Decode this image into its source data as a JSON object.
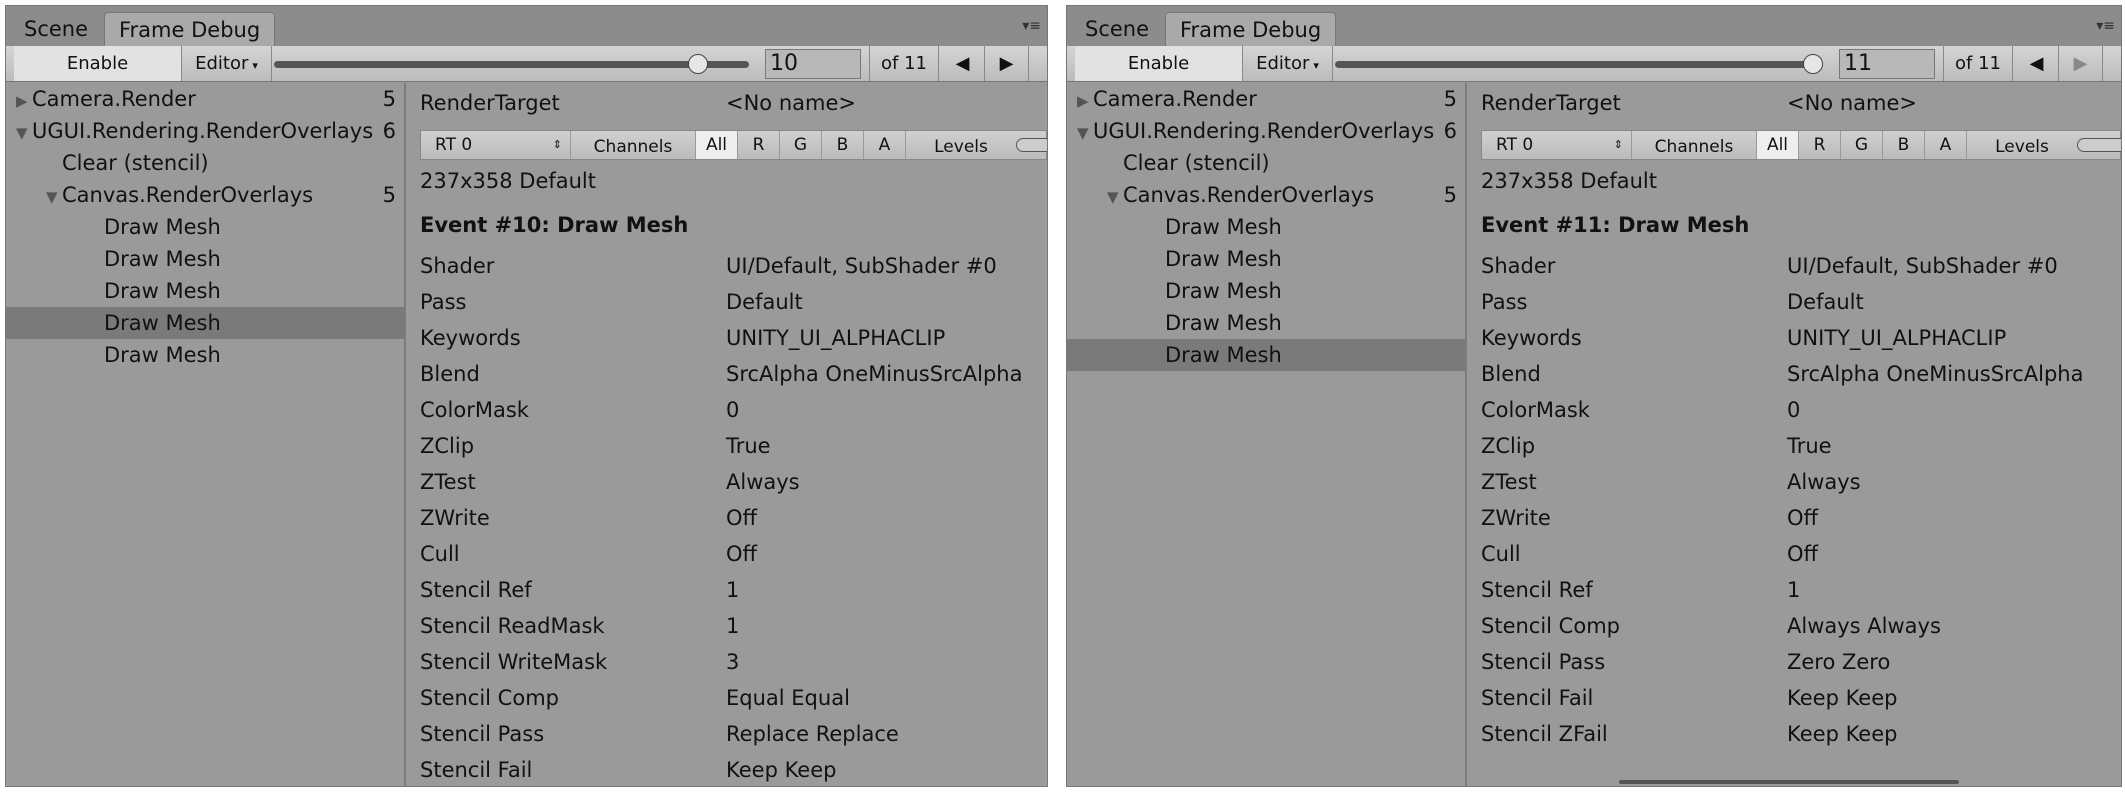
{
  "panels": [
    {
      "tabs": [
        "Scene",
        "Frame Debug"
      ],
      "active_tab": 1,
      "toolbar": {
        "enable": "Enable",
        "editor": "Editor",
        "event_value": "10",
        "of_label": "of 11",
        "slider_fraction": 0.909
      },
      "tree": [
        {
          "label": "Camera.Render",
          "count": "5",
          "arrow": "collapsed",
          "indent": 0
        },
        {
          "label": "UGUI.Rendering.RenderOverlays",
          "count": "6",
          "arrow": "expanded",
          "indent": 0
        },
        {
          "label": "Clear (stencil)",
          "count": "",
          "arrow": "",
          "indent": 1
        },
        {
          "label": "Canvas.RenderOverlays",
          "count": "5",
          "arrow": "expanded",
          "indent": 1
        },
        {
          "label": "Draw Mesh",
          "count": "",
          "arrow": "",
          "indent": 2
        },
        {
          "label": "Draw Mesh",
          "count": "",
          "arrow": "",
          "indent": 2
        },
        {
          "label": "Draw Mesh",
          "count": "",
          "arrow": "",
          "indent": 2
        },
        {
          "label": "Draw Mesh",
          "count": "",
          "arrow": "",
          "indent": 2,
          "selected": true
        },
        {
          "label": "Draw Mesh",
          "count": "",
          "arrow": "",
          "indent": 2
        }
      ],
      "render_target": {
        "label": "RenderTarget",
        "value": "<No name>"
      },
      "rt_bar": {
        "rt": "RT 0",
        "channels": "Channels",
        "buttons": [
          "All",
          "R",
          "G",
          "B",
          "A"
        ],
        "levels": "Levels"
      },
      "size_text": "237x358 Default",
      "event_title": "Event #10: Draw Mesh",
      "props": [
        [
          "Shader",
          "UI/Default, SubShader #0"
        ],
        [
          "Pass",
          "Default"
        ],
        [
          "Keywords",
          "UNITY_UI_ALPHACLIP"
        ],
        [
          "Blend",
          "SrcAlpha OneMinusSrcAlpha"
        ],
        [
          "ColorMask",
          "0"
        ],
        [
          "ZClip",
          "True"
        ],
        [
          "ZTest",
          "Always"
        ],
        [
          "ZWrite",
          "Off"
        ],
        [
          "Cull",
          "Off"
        ],
        [
          "Stencil Ref",
          "1"
        ],
        [
          "Stencil ReadMask",
          "1"
        ],
        [
          "Stencil WriteMask",
          "3"
        ],
        [
          "Stencil Comp",
          "Equal Equal"
        ],
        [
          "Stencil Pass",
          "Replace Replace"
        ],
        [
          "Stencil Fail",
          "Keep Keep"
        ]
      ]
    },
    {
      "tabs": [
        "Scene",
        "Frame Debug"
      ],
      "active_tab": 1,
      "toolbar": {
        "enable": "Enable",
        "editor": "Editor",
        "event_value": "11",
        "of_label": "of 11",
        "slider_fraction": 1.0
      },
      "tree": [
        {
          "label": "Camera.Render",
          "count": "5",
          "arrow": "collapsed",
          "indent": 0
        },
        {
          "label": "UGUI.Rendering.RenderOverlays",
          "count": "6",
          "arrow": "expanded",
          "indent": 0
        },
        {
          "label": "Clear (stencil)",
          "count": "",
          "arrow": "",
          "indent": 1
        },
        {
          "label": "Canvas.RenderOverlays",
          "count": "5",
          "arrow": "expanded",
          "indent": 1
        },
        {
          "label": "Draw Mesh",
          "count": "",
          "arrow": "",
          "indent": 2
        },
        {
          "label": "Draw Mesh",
          "count": "",
          "arrow": "",
          "indent": 2
        },
        {
          "label": "Draw Mesh",
          "count": "",
          "arrow": "",
          "indent": 2
        },
        {
          "label": "Draw Mesh",
          "count": "",
          "arrow": "",
          "indent": 2
        },
        {
          "label": "Draw Mesh",
          "count": "",
          "arrow": "",
          "indent": 2,
          "selected": true
        }
      ],
      "render_target": {
        "label": "RenderTarget",
        "value": "<No name>"
      },
      "rt_bar": {
        "rt": "RT 0",
        "channels": "Channels",
        "buttons": [
          "All",
          "R",
          "G",
          "B",
          "A"
        ],
        "levels": "Levels"
      },
      "size_text": "237x358 Default",
      "event_title": "Event #11: Draw Mesh",
      "props": [
        [
          "Shader",
          "UI/Default, SubShader #0"
        ],
        [
          "Pass",
          "Default"
        ],
        [
          "Keywords",
          "UNITY_UI_ALPHACLIP"
        ],
        [
          "Blend",
          "SrcAlpha OneMinusSrcAlpha"
        ],
        [
          "ColorMask",
          "0"
        ],
        [
          "ZClip",
          "True"
        ],
        [
          "ZTest",
          "Always"
        ],
        [
          "ZWrite",
          "Off"
        ],
        [
          "Cull",
          "Off"
        ],
        [
          "Stencil Ref",
          "1"
        ],
        [
          "Stencil Comp",
          "Always Always"
        ],
        [
          "Stencil Pass",
          "Zero Zero"
        ],
        [
          "Stencil Fail",
          "Keep Keep"
        ],
        [
          "Stencil ZFail",
          "Keep Keep"
        ]
      ]
    }
  ]
}
